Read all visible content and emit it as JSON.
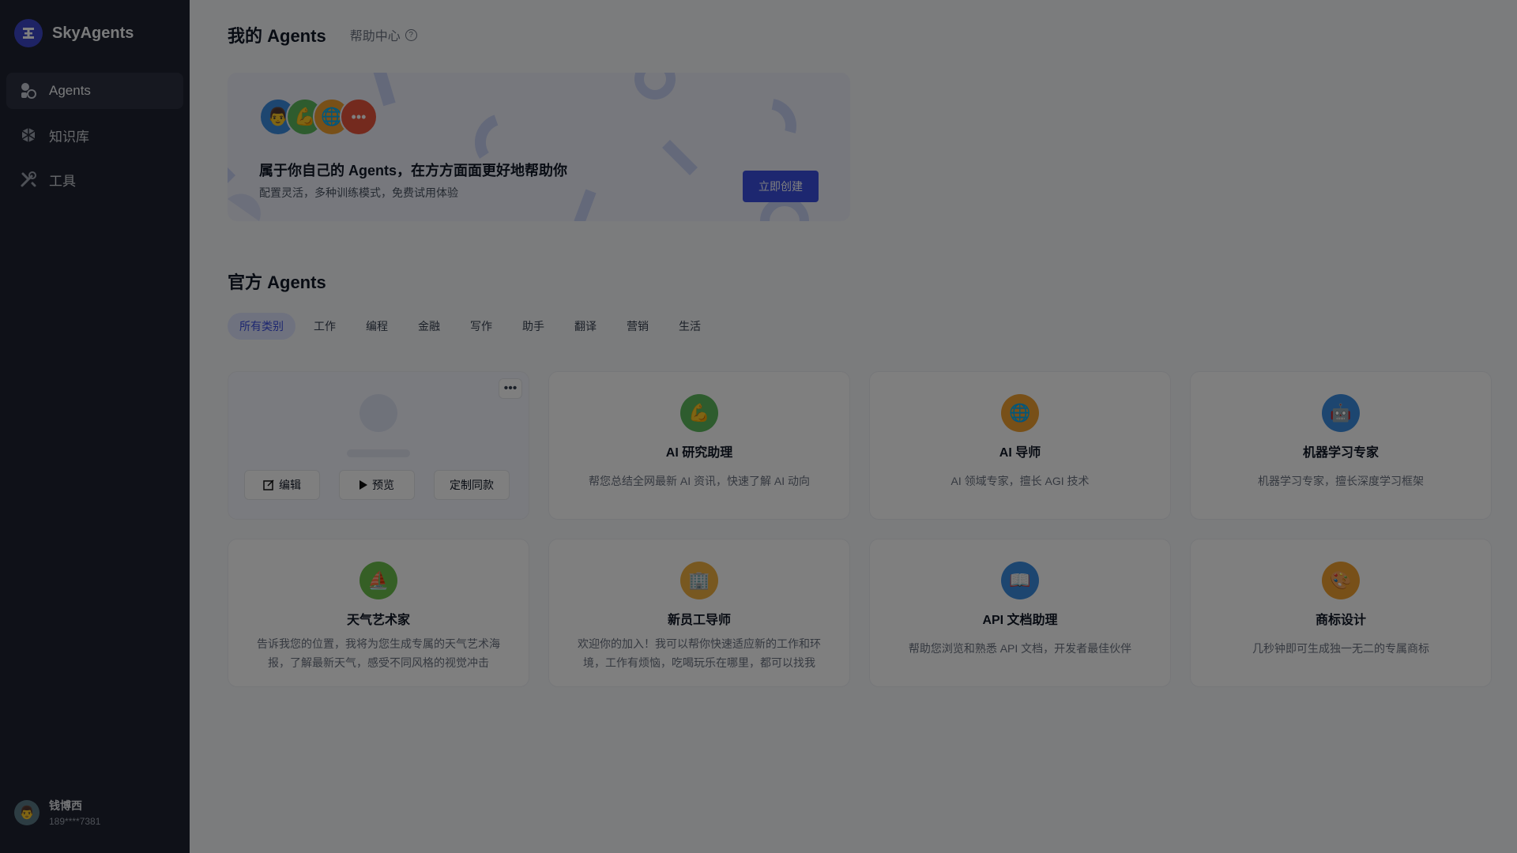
{
  "sidebar": {
    "brand": "SkyAgents",
    "items": [
      {
        "label": "Agents",
        "icon": "agents-icon"
      },
      {
        "label": "知识库",
        "icon": "knowledge-icon"
      },
      {
        "label": "工具",
        "icon": "tools-icon"
      }
    ],
    "user": {
      "name": "钱博西",
      "phone": "189****7381"
    }
  },
  "header": {
    "title": "我的 Agents",
    "help": "帮助中心"
  },
  "banner": {
    "title": "属于你自己的 Agents，在方方面面更好地帮助你",
    "subtitle": "配置灵活，多种训练模式，免费试用体验",
    "button": "立即创建"
  },
  "official": {
    "title": "官方 Agents",
    "tabs": [
      "所有类别",
      "工作",
      "编程",
      "金融",
      "写作",
      "助手",
      "翻译",
      "营销",
      "生活"
    ],
    "active_tab": "所有类别",
    "hover_card": {
      "edit": "编辑",
      "preview": "预览",
      "clone": "定制同款"
    },
    "cards": [
      {
        "title": "AI 研究助理",
        "desc": "帮您总结全网最新 AI 资讯，快速了解 AI 动向",
        "icon": "💪",
        "color": "#5cb85c"
      },
      {
        "title": "AI 导师",
        "desc": "AI 领域专家，擅长 AGI 技术",
        "icon": "🌐",
        "color": "#f0a030"
      },
      {
        "title": "机器学习专家",
        "desc": "机器学习专家，擅长深度学习框架",
        "icon": "🤖",
        "color": "#3b8ce0"
      },
      {
        "title": "天气艺术家",
        "desc": "告诉我您的位置，我将为您生成专属的天气艺术海报，了解最新天气，感受不同风格的视觉冲击",
        "icon": "⛵",
        "color": "#6bbf4a"
      },
      {
        "title": "新员工导师",
        "desc": "欢迎你的加入！我可以帮你快速适应新的工作和环境，工作有烦恼，吃喝玩乐在哪里，都可以找我",
        "icon": "🏢",
        "color": "#f0b040"
      },
      {
        "title": "API 文档助理",
        "desc": "帮助您浏览和熟悉 API 文档，开发者最佳伙伴",
        "icon": "📖",
        "color": "#3b8ce0"
      },
      {
        "title": "商标设计",
        "desc": "几秒钟即可生成独一无二的专属商标",
        "icon": "🎨",
        "color": "#f0a030"
      }
    ]
  }
}
